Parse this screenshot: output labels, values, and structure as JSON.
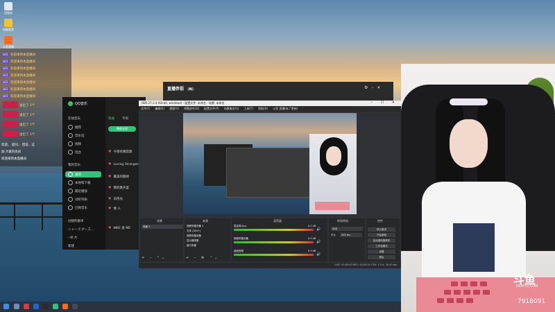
{
  "desktop": {
    "icons": [
      "回收站",
      "电脑管家",
      "",
      "斗鱼直播"
    ]
  },
  "danmaku": {
    "rows": [
      {
        "badge": "LV3",
        "name": "",
        "text": "欢迎来到本直播间"
      },
      {
        "badge": "LV3",
        "name": "",
        "text": "欢迎来到本直播间"
      },
      {
        "badge": "LV3",
        "name": "",
        "text": "欢迎来到本直播间"
      },
      {
        "badge": "LV3",
        "name": "",
        "text": "欢迎来到本直播间"
      },
      {
        "badge": "LV3",
        "name": "",
        "text": "欢迎来到本直播间"
      },
      {
        "badge": "LV3",
        "name": "",
        "text": "欢迎来到本直播间"
      },
      {
        "badge": "LV3",
        "name": "",
        "text": "欢迎来到本直播间"
      }
    ],
    "gifts": [
      {
        "text": "送出了 1个"
      },
      {
        "text": "送出了 1个"
      },
      {
        "text": "送出了 1个"
      },
      {
        "text": "送出了 1个"
      }
    ],
    "footer": [
      "欢迎， 提问， 回答，这",
      "加 大家的房间 ",
      "欢迎来到本直播间"
    ]
  },
  "qqmusic": {
    "title": "QQ音乐",
    "nav": [
      "在线音乐",
      "推荐",
      "音乐馆",
      "视频",
      "电台",
      "我的音乐",
      "喜欢",
      "本地和下载",
      "最近播放",
      "试听列表",
      "已购音乐",
      "创建的歌单",
      "ニャーゴ ボーズ…",
      "--听 片",
      "新建"
    ],
    "active_index": 5,
    "tabs": [
      "歌曲",
      "专辑"
    ],
    "play_all": "播放全部",
    "songs": [
      "今夜有哪首歌",
      "Loving Strangers",
      "最美的期待",
      "我的歌声里",
      "白月光",
      "情 人",
      "NIKE 爱 ME"
    ]
  },
  "partner": {
    "title": "直播伴侣",
    "badge": "PC"
  },
  "obs": {
    "title": "OBS 27.2.4 (64-bit, windows) - 配置文件: 未命名 - 场景: 未命名",
    "menu": [
      "文件(F)",
      "编辑(E)",
      "视图(V)",
      "停靠部件(D)",
      "配置文件(P)",
      "场景集合(S)",
      "工具(T)",
      "帮助(H)",
      "斗鱼 直播(有了更新)"
    ],
    "panels": {
      "scenes": "场景",
      "sources": "来源",
      "mixer": "混音器",
      "transitions": "转场特效",
      "controls": "控件"
    },
    "scene_items": [
      "场景 2"
    ],
    "source_items": [
      "视频采集设备 2",
      "文本 (GDI+)",
      "视频采集设备",
      "显示器采集",
      "窗口采集"
    ],
    "mixer_channels": [
      {
        "name": "麦克风/Aux",
        "db": "0.0 dB"
      },
      {
        "name": "视频采集设备",
        "db": "0.0 dB"
      },
      {
        "name": "桌面音频",
        "db": "0.0 dB"
      }
    ],
    "transition": {
      "type": "淡出",
      "duration_label": "时长",
      "duration": "300 ms"
    },
    "controls": [
      "停止推流",
      "开始录制",
      "启动虚拟摄像机",
      "工作室模式",
      "设置",
      "退出"
    ],
    "status": "LIVE: 00:00:00   REC: 00:00:00   CPU: 4.2%, 30.00 fps"
  },
  "webcam": {
    "logo": "斗鱼",
    "logo_sub": "DOUYU.COM",
    "room_id": "7918091"
  },
  "colors": {
    "qq_accent": "#31c27c",
    "douyu_pink": "#e98a95",
    "obs_bg": "#2f3136"
  }
}
